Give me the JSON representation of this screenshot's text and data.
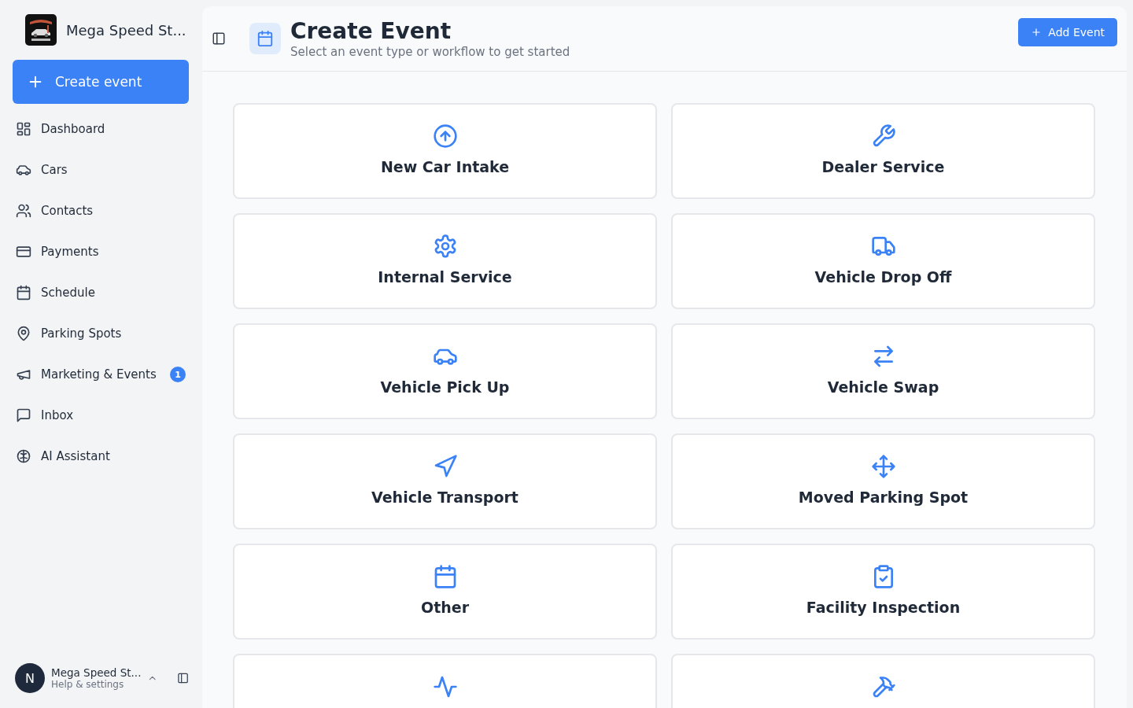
{
  "sidebar": {
    "brand": {
      "name": "Mega Speed St..."
    },
    "create_button": "Create event",
    "items": [
      {
        "kind": "dashboard",
        "label": "Dashboard"
      },
      {
        "kind": "car",
        "label": "Cars"
      },
      {
        "kind": "users",
        "label": "Contacts"
      },
      {
        "kind": "card",
        "label": "Payments"
      },
      {
        "kind": "calendar",
        "label": "Schedule"
      },
      {
        "kind": "pin",
        "label": "Parking Spots"
      },
      {
        "kind": "megaphone",
        "label": "Marketing & Events",
        "badge": "1"
      },
      {
        "kind": "message",
        "label": "Inbox"
      },
      {
        "kind": "brain",
        "label": "AI Assistant"
      }
    ],
    "user": {
      "initial": "N",
      "name": "Mega Speed St...",
      "subtitle": "Help & settings"
    }
  },
  "header": {
    "title": "Create Event",
    "subtitle": "Select an event type or workflow to get started",
    "button": "Add Event"
  },
  "cards": [
    {
      "kind": "arrow-up",
      "label": "New Car Intake"
    },
    {
      "kind": "wrench",
      "label": "Dealer Service"
    },
    {
      "kind": "gear",
      "label": "Internal Service"
    },
    {
      "kind": "truck",
      "label": "Vehicle Drop Off"
    },
    {
      "kind": "car",
      "label": "Vehicle Pick Up"
    },
    {
      "kind": "swap",
      "label": "Vehicle Swap"
    },
    {
      "kind": "send",
      "label": "Vehicle Transport"
    },
    {
      "kind": "move",
      "label": "Moved Parking Spot"
    },
    {
      "kind": "calendar",
      "label": "Other"
    },
    {
      "kind": "clipboard",
      "label": "Facility Inspection"
    },
    {
      "kind": "activity"
    },
    {
      "kind": "hammer"
    }
  ]
}
